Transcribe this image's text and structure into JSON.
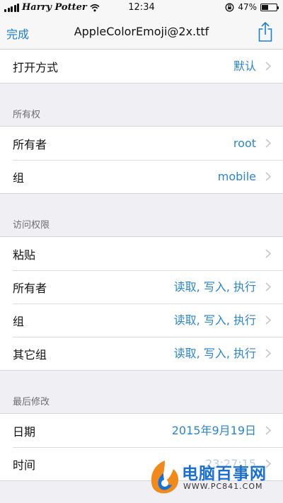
{
  "status_bar": {
    "carrier": "Harry Potter",
    "time": "12:34",
    "battery_percent": "47%",
    "battery_level": 0.47
  },
  "nav": {
    "done_label": "完成",
    "title": "AppleColorEmoji@2x.ttf",
    "share_icon": "share-icon"
  },
  "open_with": {
    "label": "打开方式",
    "value": "默认"
  },
  "ownership": {
    "header": "所有权",
    "owner_label": "所有者",
    "owner_value": "root",
    "group_label": "组",
    "group_value": "mobile"
  },
  "permissions": {
    "header": "访问权限",
    "paste_label": "粘贴",
    "owner_label": "所有者",
    "owner_value": "读取, 写入, 执行",
    "group_label": "组",
    "group_value": "读取, 写入, 执行",
    "others_label": "其它组",
    "others_value": "读取, 写入, 执行"
  },
  "modified": {
    "header": "最后修改",
    "date_label": "日期",
    "date_value": "2015年9月19日",
    "time_label": "时间",
    "time_value": "23:27:15"
  },
  "watermark": {
    "name": "电脑百事网",
    "url": "WWW.PC841.COM"
  },
  "colors": {
    "accent": "#2b86c9",
    "background": "#efeff4"
  }
}
